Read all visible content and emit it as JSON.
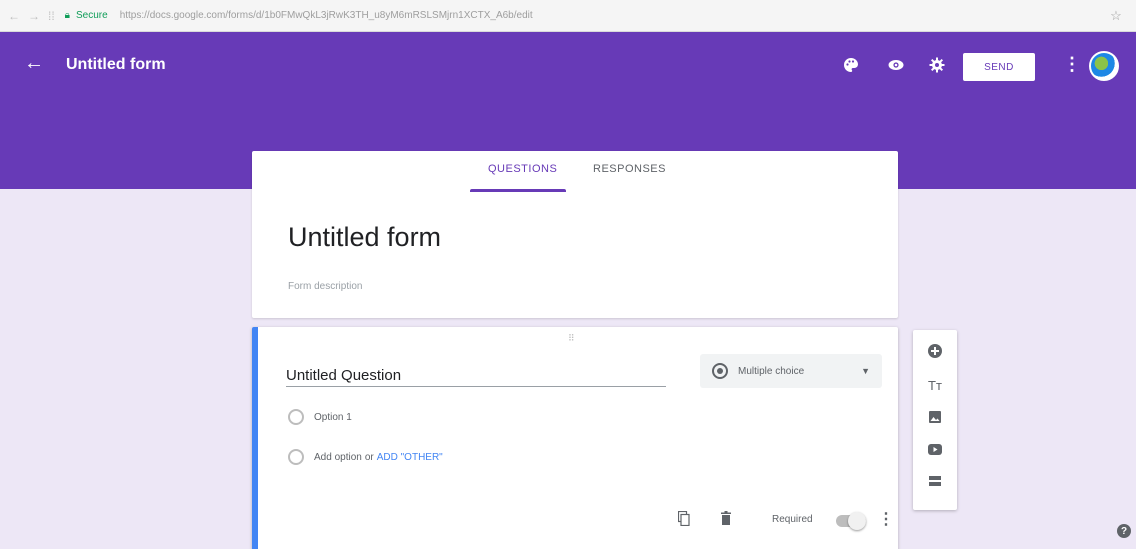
{
  "browser": {
    "secure_label": "Secure",
    "url": "https://docs.google.com/forms/d/1b0FMwQkL3jRwK3TH_u8yM6mRSLSMjrn1XCTX_A6b/edit"
  },
  "header": {
    "form_name": "Untitled form",
    "send_label": "SEND",
    "icons": [
      "palette-icon",
      "eye-icon",
      "gear-icon",
      "more-vert-icon"
    ]
  },
  "tabs": {
    "questions": "QUESTIONS",
    "responses": "RESPONSES",
    "active": "questions"
  },
  "form": {
    "title": "Untitled form",
    "description_placeholder": "Form description"
  },
  "question": {
    "title": "Untitled Question",
    "type": "Multiple choice",
    "options": [
      "Option 1"
    ],
    "add_option": "Add option",
    "add_or": "or",
    "add_other": "ADD \"OTHER\"",
    "required_label": "Required",
    "required": false
  },
  "sidebar": {
    "items": [
      "add-question-icon",
      "title-icon",
      "image-icon",
      "video-icon",
      "section-icon"
    ],
    "title_glyph": "Tт"
  },
  "colors": {
    "brand": "#673ab7",
    "background": "#ede7f6",
    "active_question_border": "#4285f4"
  }
}
